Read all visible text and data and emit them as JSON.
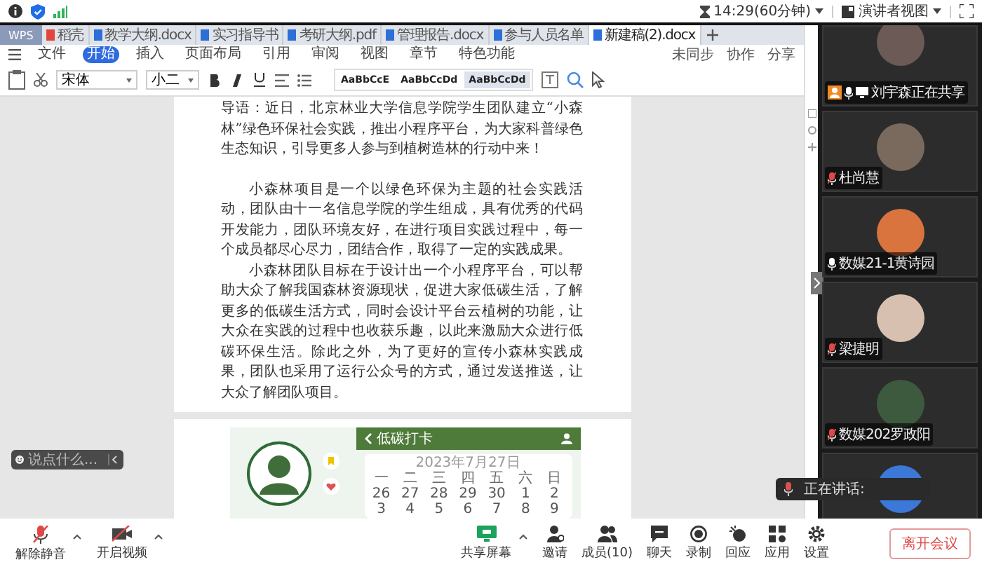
{
  "status_bar": {
    "meeting_time": "14:29(60分钟)",
    "view_button": "演讲者视图"
  },
  "wps": {
    "app_tab": "WPS",
    "tabs": [
      {
        "label": "稻壳",
        "selected": false
      },
      {
        "label": "教学大纲.docx",
        "selected": false
      },
      {
        "label": "实习指导书",
        "selected": false
      },
      {
        "label": "考研大纲.pdf",
        "selected": false
      },
      {
        "label": "管理报告.docx",
        "selected": false
      },
      {
        "label": "参与人员名单",
        "selected": false
      },
      {
        "label": "新建稿(2).docx",
        "selected": true
      }
    ],
    "menu": [
      {
        "label": "文件",
        "selected": false
      },
      {
        "label": "开始",
        "selected": true
      },
      {
        "label": "插入",
        "selected": false
      },
      {
        "label": "页面布局",
        "selected": false
      },
      {
        "label": "引用",
        "selected": false
      },
      {
        "label": "审阅",
        "selected": false
      },
      {
        "label": "视图",
        "selected": false
      },
      {
        "label": "章节",
        "selected": false
      },
      {
        "label": "特色功能",
        "selected": false
      }
    ],
    "actions": [
      "未同步",
      "协作",
      "分享"
    ],
    "font_name": "宋体",
    "font_size": "小二",
    "styles": [
      "AaBbCcE",
      "AaBbCcDd",
      "AaBbCcDd"
    ],
    "paragraphs": [
      {
        "text": "导语：近日，北京林业大学信息学院学生团队建立“小森林”绿色环保社会实践，推出小程序平台，为大家科普绿色生态知识，引导更多人参与到植树造林的行动中来！",
        "indent": false
      },
      {
        "text": "小森林项目是一个以绿色环保为主题的社会实践活动，团队由十一名信息学院的学生组成，具有优秀的代码开发能力，团队环境友好，在进行项目实践过程中，每一个成员都尽心尽力，团结合作，取得了一定的实践成果。",
        "indent": true
      },
      {
        "text": "小森林团队目标在于设计出一个小程序平台，可以帮助大众了解我国森林资源现状，促进大家低碳生活，了解更多的低碳生活方式，同时会设计平台云植树的功能，让大众在实践的过程中也收获乐趣，以此来激励大众进行低碳环保生活。除此之外，为了更好的宣传小森林实践成果，团队也采用了运行公众号的方式，通过发送推送，让大众了解团队项目。",
        "indent": true
      }
    ],
    "mockup": {
      "title": "低碳打卡",
      "date": "2023年7月27日",
      "weekdays": [
        "一",
        "二",
        "三",
        "四",
        "五",
        "六",
        "日"
      ],
      "weeks": [
        [
          "26",
          "27",
          "28",
          "29",
          "30",
          "1",
          "2"
        ],
        [
          "3",
          "4",
          "5",
          "6",
          "7",
          "8",
          "9"
        ]
      ]
    }
  },
  "chat_input": {
    "placeholder": "说点什么..."
  },
  "participants": [
    {
      "name": "刘宇森正在共享",
      "sharing": true,
      "muted": false
    },
    {
      "name": "杜尚慧",
      "sharing": false,
      "muted": true
    },
    {
      "name": "数媒21-1黄诗园",
      "sharing": false,
      "muted": false
    },
    {
      "name": "梁捷明",
      "sharing": false,
      "muted": true
    },
    {
      "name": "数媒202罗政阳",
      "sharing": false,
      "muted": true
    }
  ],
  "speaking_toast": {
    "label": "正在讲话:"
  },
  "toolbar": {
    "left": [
      {
        "label": "解除静音",
        "kind": "mic-off"
      },
      {
        "label": "开启视频",
        "kind": "video-off"
      }
    ],
    "center": [
      {
        "label": "共享屏幕",
        "kind": "share"
      },
      {
        "label": "邀请",
        "kind": "invite"
      },
      {
        "label": "成员(10)",
        "kind": "members"
      },
      {
        "label": "聊天",
        "kind": "chat"
      },
      {
        "label": "录制",
        "kind": "record"
      },
      {
        "label": "回应",
        "kind": "react"
      },
      {
        "label": "应用",
        "kind": "apps"
      },
      {
        "label": "设置",
        "kind": "settings"
      }
    ],
    "leave": "离开会议"
  }
}
